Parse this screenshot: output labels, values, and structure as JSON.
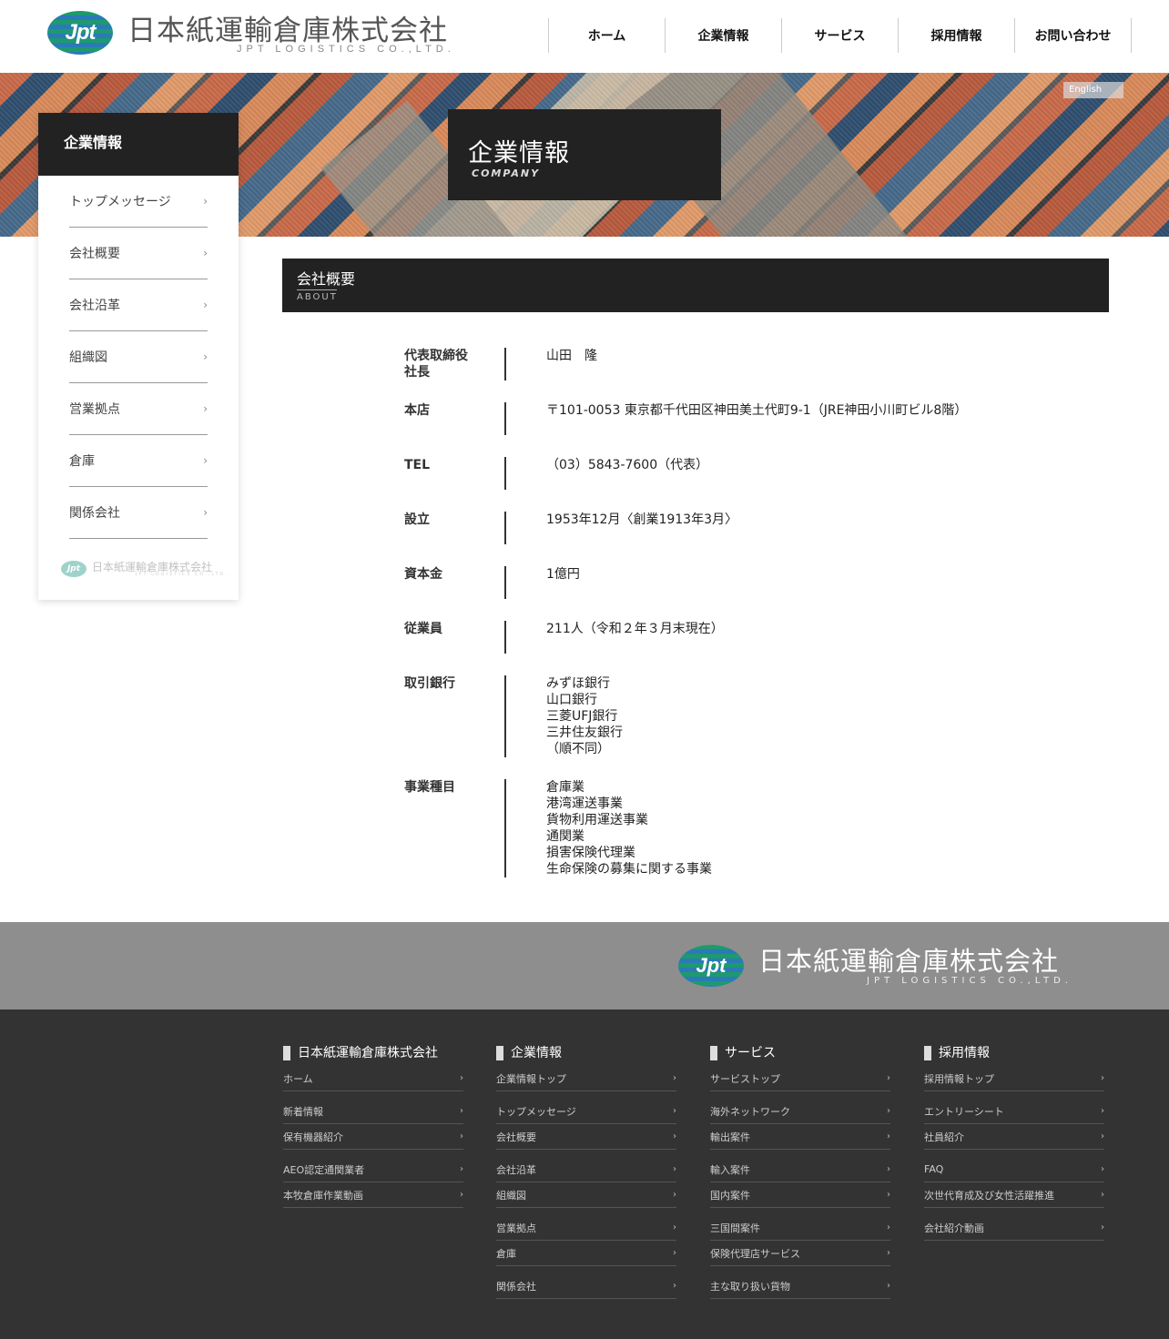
{
  "header": {
    "logo_mark": "Jpt",
    "logo_jp": "日本紙運輸倉庫株式会社",
    "logo_en": "JPT LOGISTICS CO.,LTD.",
    "nav": [
      "ホーム",
      "企業情報",
      "サービス",
      "採用情報",
      "お問い合わせ"
    ]
  },
  "hero": {
    "title_jp": "企業情報",
    "title_en": "COMPANY",
    "english_link": "English"
  },
  "sidebar": {
    "heading": "企業情報",
    "items": [
      "トップメッセージ",
      "会社概要",
      "会社沿革",
      "組織図",
      "営業拠点",
      "倉庫",
      "関係会社"
    ],
    "chevron": "›",
    "logo_jp": "日本紙運輸倉庫株式会社",
    "logo_en": "JPT LOGISTICS CO.,LTD."
  },
  "section": {
    "title_jp": "会社概要",
    "title_en": "ABOUT"
  },
  "info": [
    {
      "label": "代表取締役\n社長",
      "value": "山田　隆"
    },
    {
      "label": "本店",
      "value": "〒101-0053 東京都千代田区神田美土代町9-1（JRE神田小川町ビル8階）"
    },
    {
      "label": "TEL",
      "value": "（03）5843-7600（代表）"
    },
    {
      "label": "設立",
      "value": "1953年12月〈創業1913年3月〉"
    },
    {
      "label": "資本金",
      "value": "1億円"
    },
    {
      "label": "従業員",
      "value": "211人（令和２年３月末現在）"
    },
    {
      "label": "取引銀行",
      "value": "みずほ銀行\n山口銀行\n三菱UFJ銀行\n三井住友銀行\n（順不同）"
    },
    {
      "label": "事業種目",
      "value": "倉庫業\n港湾運送事業\n貨物利用運送事業\n通関業\n損害保険代理業\n生命保険の募集に関する事業"
    }
  ],
  "footer": {
    "logo_mark": "Jpt",
    "logo_jp": "日本紙運輸倉庫株式会社",
    "logo_en": "JPT LOGISTICS CO.,LTD.",
    "columns": [
      {
        "heading": "日本紙運輸倉庫株式会社",
        "links": [
          "ホーム",
          "新着情報",
          "保有機器紹介",
          "AEO認定通関業者",
          "本牧倉庫作業動画"
        ]
      },
      {
        "heading": "企業情報",
        "links": [
          "企業情報トップ",
          "トップメッセージ",
          "会社概要",
          "会社沿革",
          "組織図",
          "営業拠点",
          "倉庫",
          "関係会社"
        ]
      },
      {
        "heading": "サービス",
        "links": [
          "サービストップ",
          "海外ネットワーク",
          "輸出案件",
          "輸入案件",
          "国内案件",
          "三国間案件",
          "保険代理店サービス",
          "主な取り扱い貨物"
        ]
      },
      {
        "heading": "採用情報",
        "links": [
          "採用情報トップ",
          "エントリーシート",
          "社員紹介",
          "FAQ",
          "次世代育成及び女性活躍推進",
          "会社紹介動画"
        ]
      }
    ]
  }
}
